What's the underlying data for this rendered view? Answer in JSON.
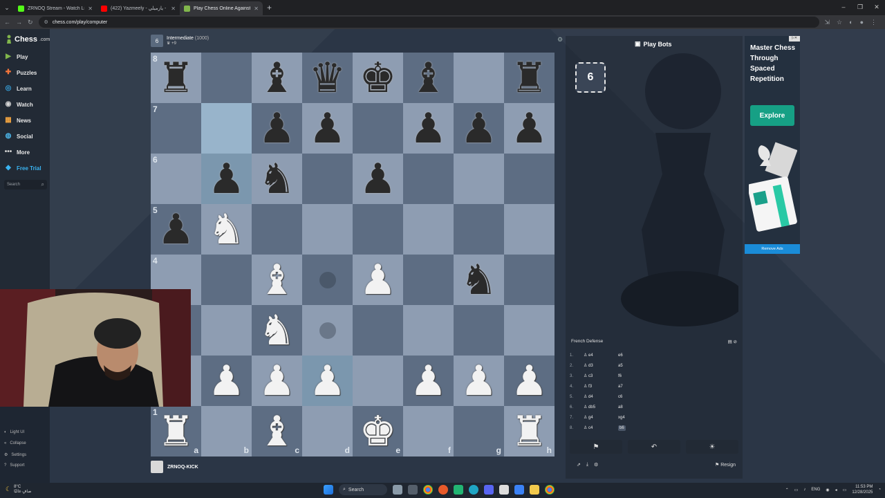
{
  "browser": {
    "tabs": [
      {
        "label": "ZRNOQ Stream - Watch Live on",
        "color": "#53fc18",
        "active": false
      },
      {
        "label": "(422) Yazmeely - يازميلي - YouTube",
        "color": "#ff0000",
        "active": false
      },
      {
        "label": "Play Chess Online Against th",
        "color": "#81b64c",
        "active": true
      }
    ],
    "url": "chess.com/play/computer"
  },
  "sidebar": {
    "logo_text": "Chess",
    "logo_domain": ".com",
    "items": [
      {
        "label": "Play",
        "icon": "play-icon",
        "color": "#81b64c"
      },
      {
        "label": "Puzzles",
        "icon": "puzzle-icon",
        "color": "#f2753b"
      },
      {
        "label": "Learn",
        "icon": "learn-icon",
        "color": "#36a4e0"
      },
      {
        "label": "Watch",
        "icon": "watch-icon",
        "color": "#d6d6d6"
      },
      {
        "label": "News",
        "icon": "news-icon",
        "color": "#f0a340"
      },
      {
        "label": "Social",
        "icon": "social-icon",
        "color": "#4cb5e8"
      },
      {
        "label": "More",
        "icon": "more-icon",
        "color": "#d6d6d6"
      },
      {
        "label": "Free Trial",
        "icon": "diamond-icon",
        "color": "#3ab4f2"
      }
    ],
    "search_placeholder": "Search",
    "bottom": [
      {
        "label": "Light UI",
        "icon": "light-ui-icon"
      },
      {
        "label": "Collapse",
        "icon": "collapse-icon"
      },
      {
        "label": "Settings",
        "icon": "settings-icon"
      },
      {
        "label": "Support",
        "icon": "support-icon"
      }
    ]
  },
  "opponent": {
    "name": "Intermediate",
    "rating": "(1000)",
    "sub": "+9",
    "avatar": "6"
  },
  "player": {
    "name": "ZRNOQ-KICK"
  },
  "board": {
    "ranks": [
      "8",
      "7",
      "6",
      "5",
      "4",
      "3",
      "2",
      "1"
    ],
    "files": [
      "a",
      "b",
      "c",
      "d",
      "e",
      "f",
      "g",
      "h"
    ],
    "position": [
      [
        "r",
        "",
        "b",
        "q",
        "k",
        "b",
        "",
        "r"
      ],
      [
        "",
        "",
        "p",
        "p",
        "",
        "p",
        "p",
        "p"
      ],
      [
        "",
        "p",
        "n",
        "",
        "p",
        "",
        "",
        ""
      ],
      [
        "p",
        "N",
        "",
        "",
        "",
        "",
        "",
        ""
      ],
      [
        "",
        "",
        "B",
        "",
        "P",
        "",
        "n",
        ""
      ],
      [
        "",
        "",
        "N",
        "",
        "",
        "",
        "",
        ""
      ],
      [
        "",
        "P",
        "P",
        "P",
        "",
        "P",
        "P",
        "P"
      ],
      [
        "R",
        "",
        "B",
        "",
        "K",
        "",
        "",
        "R"
      ]
    ],
    "highlights": [
      "b7",
      "b6",
      "d2"
    ],
    "move_dots": [
      "d4",
      "d3"
    ]
  },
  "panel": {
    "title": "Play Bots",
    "bot_level": "6",
    "opening": "French Defense",
    "moves": [
      {
        "n": "1.",
        "w": "e4",
        "b": "e6"
      },
      {
        "n": "2.",
        "w": "d3",
        "b": "a5"
      },
      {
        "n": "3.",
        "w": "c3",
        "b": "f6"
      },
      {
        "n": "4.",
        "w": "f3",
        "b": "a7"
      },
      {
        "n": "5.",
        "w": "d4",
        "b": "c6"
      },
      {
        "n": "6.",
        "w": "db5",
        "b": "a8"
      },
      {
        "n": "7.",
        "w": "g4",
        "b": "xg4"
      },
      {
        "n": "8.",
        "w": "c4",
        "b": "b6"
      }
    ],
    "resign_label": "Resign"
  },
  "ad": {
    "headline": "Master Chess Through Spaced Repetition",
    "button": "Explore",
    "remove": "Remove Ads"
  },
  "taskbar": {
    "weather_temp": "8°C",
    "weather_desc": "صافٍ غالبًا",
    "search": "Search",
    "lang": "ENG",
    "time": "11:53 PM",
    "date": "12/28/2025"
  }
}
